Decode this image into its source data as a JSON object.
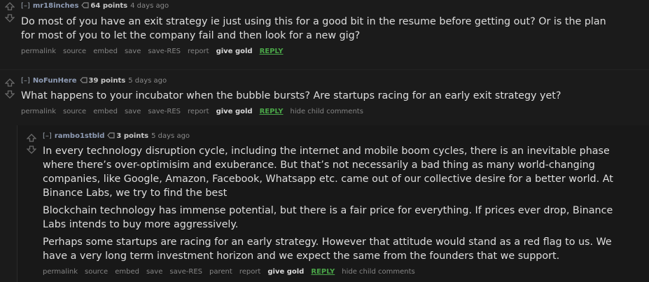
{
  "comments": [
    {
      "toggle": "[–]",
      "author": "mr18inches",
      "score": "64 points",
      "time": "4 days ago",
      "body": [
        "Do most of you have an exit strategy ie just using this for a good bit in the resume before getting out? Or is the plan for most of you to let the company fail and then look for a new gig?"
      ],
      "buttons": [
        "permalink",
        "source",
        "embed",
        "save",
        "save-RES",
        "report",
        "give gold",
        "REPLY"
      ]
    },
    {
      "toggle": "[–]",
      "author": "NoFunHere",
      "score": "39 points",
      "time": "5 days ago",
      "body": [
        "What happens to your incubator when the bubble bursts? Are startups racing for an early exit strategy yet?"
      ],
      "buttons": [
        "permalink",
        "source",
        "embed",
        "save",
        "save-RES",
        "report",
        "give gold",
        "REPLY",
        "hide child comments"
      ]
    },
    {
      "toggle": "[–]",
      "author": "rambo1stbld",
      "score": "3 points",
      "time": "5 days ago",
      "body": [
        "In every technology disruption cycle, including the internet and mobile boom cycles, there is an inevitable phase where there’s over-optimisim and exuberance. But that’s not necessarily a bad thing as many world-changing companies, like Google, Amazon, Facebook, Whatsapp etc. came out of our collective desire for a better world. At Binance Labs, we try to find the best",
        "Blockchain technology has immense potential, but there is a fair price for everything. If prices ever drop, Binance Labs intends to buy more aggressively.",
        "Perhaps some startups are racing for an early strategy. However that attitude would stand as a red flag to us. We have a very long term investment horizon and we expect the same from the founders that we support."
      ],
      "buttons": [
        "permalink",
        "source",
        "embed",
        "save",
        "save-RES",
        "parent",
        "report",
        "give gold",
        "REPLY",
        "hide child comments"
      ]
    }
  ]
}
